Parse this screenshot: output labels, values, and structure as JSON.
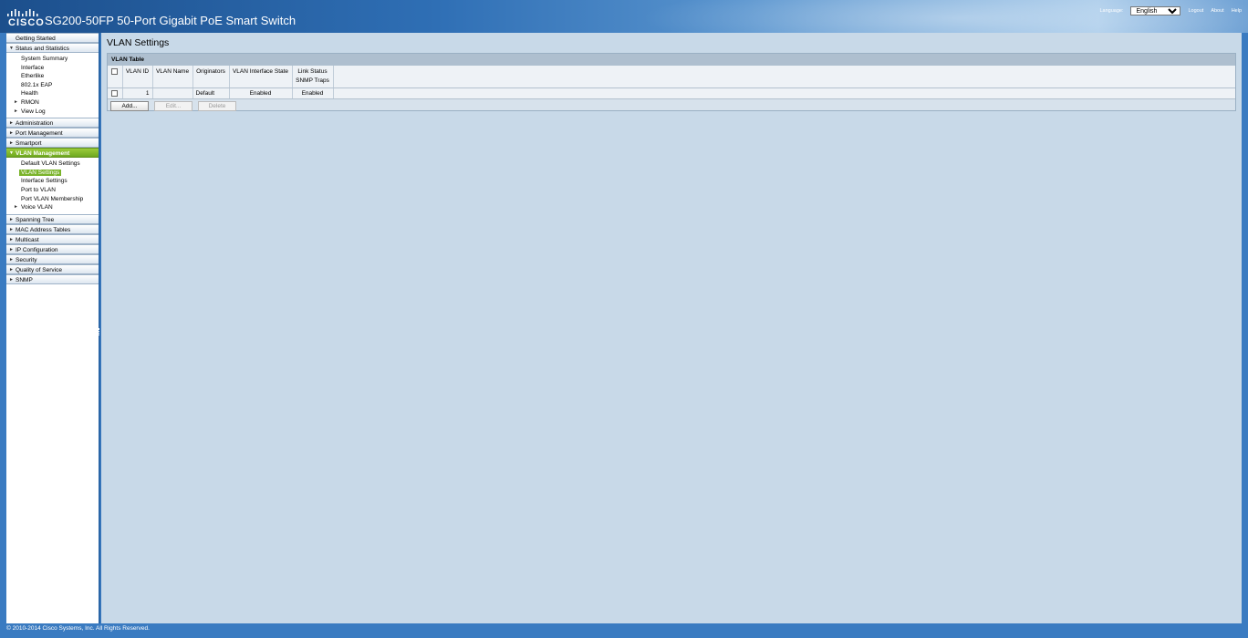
{
  "header": {
    "logo_text": "CISCO",
    "app_title": "SG200-50FP 50-Port Gigabit PoE Smart Switch",
    "language_label": "Language:",
    "language_value": "English",
    "logout": "Logout",
    "about": "About",
    "help": "Help"
  },
  "sidebar": {
    "getting_started": "Getting Started",
    "status": "Status and Statistics",
    "status_items": [
      "System Summary",
      "Interface",
      "Etherlike",
      "802.1x EAP",
      "Health",
      "RMON",
      "View Log"
    ],
    "administration": "Administration",
    "port_management": "Port Management",
    "smartport": "Smartport",
    "vlan_management": "VLAN Management",
    "vlan_items": [
      "Default VLAN Settings",
      "VLAN Settings",
      "Interface Settings",
      "Port to VLAN",
      "Port VLAN Membership",
      "Voice VLAN"
    ],
    "spanning_tree": "Spanning Tree",
    "mac_tables": "MAC Address Tables",
    "multicast": "Multicast",
    "ip_config": "IP Configuration",
    "security": "Security",
    "qos": "Quality of Service",
    "snmp": "SNMP"
  },
  "main": {
    "title": "VLAN Settings",
    "panel_title": "VLAN Table",
    "columns": {
      "vlan_id": "VLAN ID",
      "vlan_name": "VLAN Name",
      "originators": "Originators",
      "interface_state": "VLAN Interface State",
      "link_status_1": "Link Status",
      "link_status_2": "SNMP Traps"
    },
    "rows": [
      {
        "vlan_id": "1",
        "vlan_name": "",
        "originators": "Default",
        "interface_state": "Enabled",
        "link_status": "Enabled"
      }
    ],
    "buttons": {
      "add": "Add...",
      "edit": "Edit...",
      "delete": "Delete"
    }
  },
  "footer": {
    "copyright": "© 2010-2014 Cisco Systems, Inc. All Rights Reserved."
  },
  "colors": {
    "accent_green": "#7ab32a",
    "header_blue": "#1c4f8c",
    "content_bg": "#c8d9e8"
  }
}
